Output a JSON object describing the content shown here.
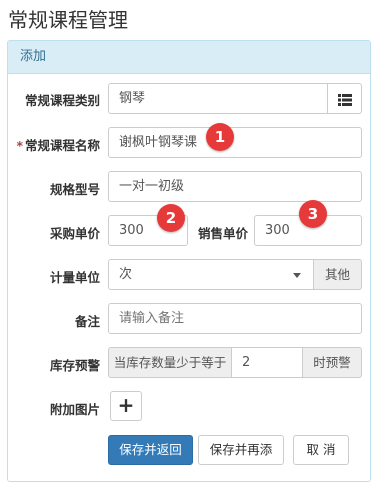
{
  "page": {
    "title": "常规课程管理"
  },
  "panel": {
    "heading": "添加"
  },
  "form": {
    "category": {
      "label": "常规课程类别",
      "value": "钢琴"
    },
    "name": {
      "required_mark": "*",
      "label": "常规课程名称",
      "value": "谢枫叶钢琴课"
    },
    "spec": {
      "label": "规格型号",
      "value": "一对一初级"
    },
    "purchase_price": {
      "label": "采购单价",
      "value": "300"
    },
    "sale_price": {
      "label": "销售单价",
      "value": "300"
    },
    "unit": {
      "label": "计量单位",
      "value": "次",
      "other_label": "其他"
    },
    "remark": {
      "label": "备注",
      "placeholder": "请输入备注"
    },
    "stock_alert": {
      "label": "库存预警",
      "prefix": "当库存数量少于等于",
      "value": "2",
      "suffix": "时预警"
    },
    "image": {
      "label": "附加图片",
      "add_symbol": "+"
    }
  },
  "buttons": {
    "save_return": "保存并返回",
    "save_add": "保存并再添",
    "cancel": "取 消"
  },
  "annotations": [
    "1",
    "2",
    "3"
  ],
  "colors": {
    "primary": "#337ab7",
    "panel_heading_bg": "#d9edf7",
    "badge": "#e63a3a"
  }
}
